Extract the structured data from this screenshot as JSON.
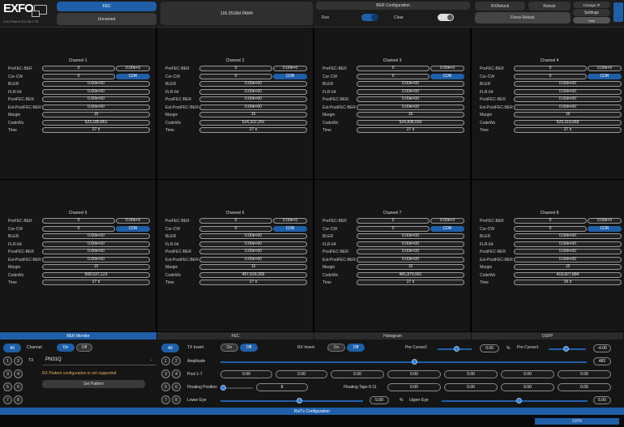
{
  "header": {
    "logo": "EXFO",
    "logo_sub": "1.6.0   Port 4   172.16.7.70",
    "fec_label": "FEC",
    "unnamed_label": "Unnamed",
    "speed_label": "106.25GBd PAM4",
    "ber_config_label": "BER Configuration",
    "run_label": "Run",
    "clear_label": "Clear",
    "run_on": true,
    "clear_on": false,
    "rxrelock_label": "RXRelock",
    "relock_label": "Relock",
    "force_relock_label": "Force Relock",
    "change_ip_label": "Change IP",
    "settings_label": "Settings",
    "help_label": "Help"
  },
  "row_labels": {
    "prefec_ber": "PreFEC-BER",
    "cor_cw": "Cor-CW",
    "bler": "BLER",
    "flr64": "FLR-64",
    "postfec_ber": "PostFEC-BER",
    "est_postfec_ber": "Est-PostFEC-BER",
    "margin": "Margin",
    "codewords": "CodeWs",
    "time": "Time",
    "cdr": "CDR"
  },
  "channels": [
    {
      "title": "Channel 1",
      "prefec_count": "0",
      "prefec_ber": "0.00e+0",
      "cor_cw": "0",
      "bler": "0.00e+00",
      "flr64": "0.00e+00",
      "postfec_ber": "0.00e+00",
      "est_postfec_ber": "0.00e+00",
      "margin": "15",
      "codewords": "523,185,861",
      "time": "27 s"
    },
    {
      "title": "Channel 2",
      "prefec_count": "0",
      "prefec_ber": "0.00e+0",
      "cor_cw": "0",
      "bler": "0.00e+00",
      "flr64": "0.00e+00",
      "postfec_ber": "0.00e+00",
      "est_postfec_ber": "0.00e+00",
      "margin": "15",
      "codewords": "524,322,291",
      "time": "27 s"
    },
    {
      "title": "Channel 3",
      "prefec_count": "0",
      "prefec_ber": "0.00e+0",
      "cor_cw": "0",
      "bler": "0.00e+00",
      "flr64": "0.00e+00",
      "postfec_ber": "0.00e+00",
      "est_postfec_ber": "0.00e+00",
      "margin": "15",
      "codewords": "524,838,550",
      "time": "27 s"
    },
    {
      "title": "Channel 4",
      "prefec_count": "0",
      "prefec_ber": "0.00e+0",
      "cor_cw": "0",
      "bler": "0.00e+00",
      "flr64": "0.00e+00",
      "postfec_ber": "0.00e+00",
      "est_postfec_ber": "0.00e+00",
      "margin": "15",
      "codewords": "529,319,969",
      "time": "27 s"
    },
    {
      "title": "Channel 5",
      "prefec_count": "0",
      "prefec_ber": "0.00e+0",
      "cor_cw": "0",
      "bler": "0.00e+00",
      "flr64": "0.00e+00",
      "postfec_ber": "0.00e+00",
      "est_postfec_ber": "0.00e+00",
      "margin": "15",
      "codewords": "508,537,123",
      "time": "27 s"
    },
    {
      "title": "Channel 6",
      "prefec_count": "0",
      "prefec_ber": "0.00e+0",
      "cor_cw": "0",
      "bler": "0.00e+00",
      "flr64": "0.00e+00",
      "postfec_ber": "0.00e+00",
      "est_postfec_ber": "0.00e+00",
      "margin": "15",
      "codewords": "497,618,365",
      "time": "27 s"
    },
    {
      "title": "Channel 7",
      "prefec_count": "0",
      "prefec_ber": "0.00e+0",
      "cor_cw": "0",
      "bler": "0.00e+00",
      "flr64": "0.00e+00",
      "postfec_ber": "0.00e+00",
      "est_postfec_ber": "0.00e+00",
      "margin": "15",
      "codewords": "481,879,991",
      "time": "27 s"
    },
    {
      "title": "Channel 8",
      "prefec_count": "0",
      "prefec_ber": "0.00e+0",
      "cor_cw": "0",
      "bler": "0.00e+00",
      "flr64": "0.00e+00",
      "postfec_ber": "0.00e+00",
      "est_postfec_ber": "0.00e+00",
      "margin": "15",
      "codewords": "418,827,884",
      "time": "26 s"
    }
  ],
  "bottom": {
    "tabs": [
      "BER Monitor",
      "FEC",
      "Histogram",
      "OSFP"
    ],
    "active_tab": 0,
    "all_label": "All",
    "channel_label": "Channel",
    "on_label": "On",
    "off_label": "Off",
    "tx_label": "TX",
    "pattern_value": "PN31Q",
    "warning": "RX Pattern configuration is not supported",
    "set_pattern_label": "Set Pattern",
    "lane_buttons": [
      "1",
      "2",
      "3",
      "4",
      "5",
      "6",
      "7",
      "8"
    ],
    "tx_invert_label": "TX Invert",
    "rx_invert_label": "RX Invert",
    "pre_cursor2_label": "Pre Cursor2",
    "pre_cursor2_value": "0.00",
    "percent_label": "%",
    "pre_cursor1_label": "Pre Cursor1",
    "pre_cursor1_value": "-4.00",
    "amplitude_label": "Amplitude",
    "amplitude_value": "482",
    "post17_label": "Post 1-7",
    "post_values": [
      "0.00",
      "0.00",
      "0.00",
      "0.00",
      "0.00",
      "0.00",
      "0.00"
    ],
    "floating_position_label": "Floating Position",
    "floating_position_value": "8",
    "floating_taps_label": "Floating Taps 8-11",
    "floating_taps_values": [
      "0.00",
      "0.00",
      "0.00",
      "0.00"
    ],
    "lower_eye_label": "Lower Eye",
    "lower_eye_value": "5.00",
    "upper_eye_label": "Upper Eye",
    "upper_eye_value": "5.00",
    "footer_tab": "Rx/Tx Configuration",
    "progress_label": "100%",
    "progress": 1.0
  },
  "colors": {
    "accent": "#1f5fa8",
    "panel": "#161616",
    "warning": "#e0b060"
  }
}
